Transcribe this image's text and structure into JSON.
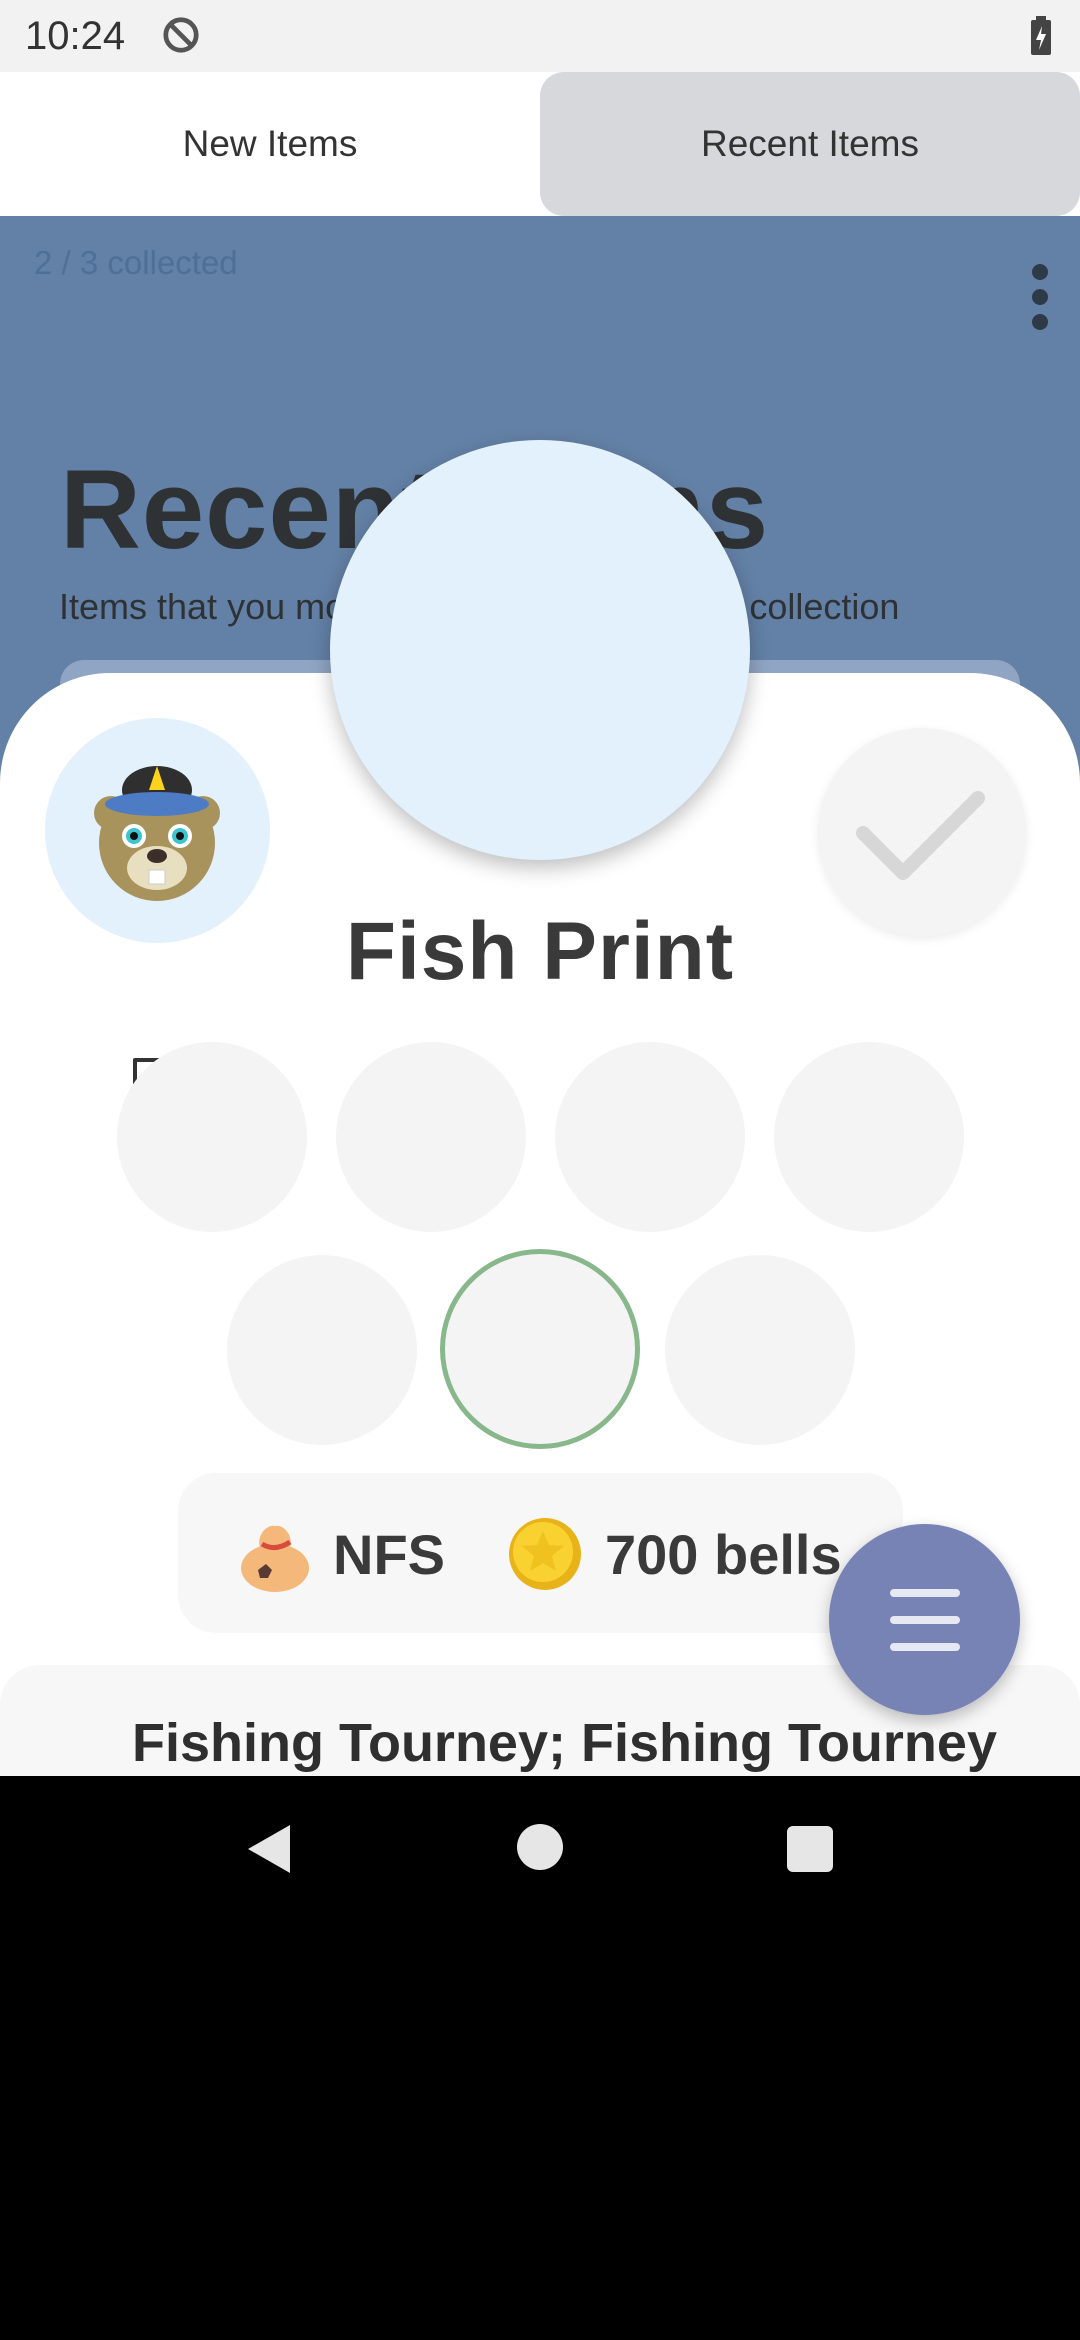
{
  "status_bar": {
    "time": "10:24"
  },
  "tabs": [
    {
      "label": "New Items",
      "selected": false
    },
    {
      "label": "Recent Items",
      "selected": true
    }
  ],
  "background": {
    "collected": "2 / 3 collected",
    "heading": "Recent Items",
    "subheading": "Items that you most recently added to your collection"
  },
  "item": {
    "name": "Fish Print",
    "availability": "NFS",
    "price": "700 bells",
    "source": "Fishing Tourney; Fishing Tourney"
  },
  "icons": {
    "villager": "beaver-villager-icon",
    "check": "check-icon",
    "bookmark": "bookmark-icon",
    "money_bag": "money-bag-icon",
    "bell": "bell-coin-icon",
    "menu": "menu-icon"
  },
  "colors": {
    "background_blue": "#6380a6",
    "accent_green": "#88b78c",
    "fab_purple": "#7683b4"
  }
}
